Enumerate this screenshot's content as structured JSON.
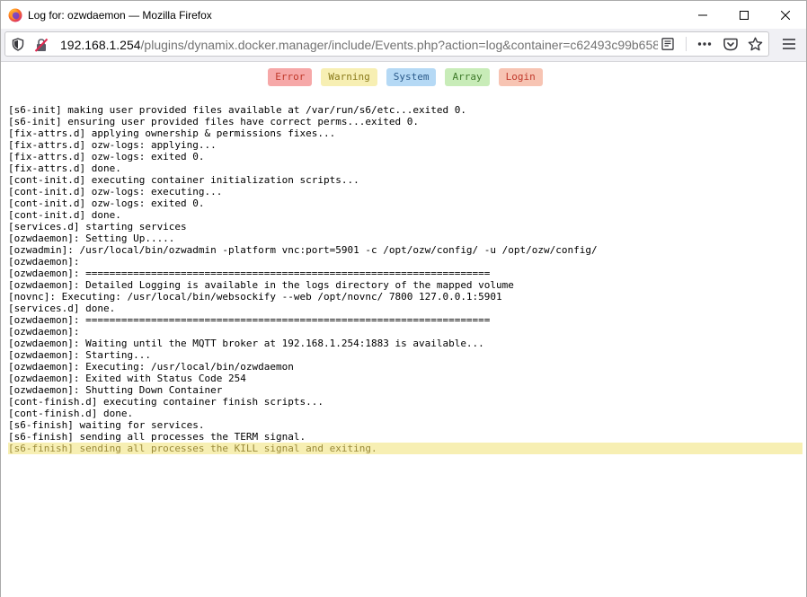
{
  "window": {
    "title": "Log for: ozwdaemon — Mozilla Firefox"
  },
  "urlbar": {
    "host": "192.168.1.254",
    "path": "/plugins/dynamix.docker.manager/include/Events.php?action=log&container=c62493c99b658"
  },
  "filters": [
    {
      "label": "Error",
      "bg": "#f6a8a8",
      "fg": "#c0392b"
    },
    {
      "label": "Warning",
      "bg": "#f7efb3",
      "fg": "#8a7a1a"
    },
    {
      "label": "System",
      "bg": "#b5d9f5",
      "fg": "#2a5a8a"
    },
    {
      "label": "Array",
      "bg": "#c8ecb8",
      "fg": "#3f7a2a"
    },
    {
      "label": "Login",
      "bg": "#f7c4b3",
      "fg": "#c0392b"
    }
  ],
  "log_lines": [
    "[s6-init] making user provided files available at /var/run/s6/etc...exited 0.",
    "[s6-init] ensuring user provided files have correct perms...exited 0.",
    "[fix-attrs.d] applying ownership & permissions fixes...",
    "[fix-attrs.d] ozw-logs: applying...",
    "[fix-attrs.d] ozw-logs: exited 0.",
    "[fix-attrs.d] done.",
    "[cont-init.d] executing container initialization scripts...",
    "[cont-init.d] ozw-logs: executing...",
    "[cont-init.d] ozw-logs: exited 0.",
    "[cont-init.d] done.",
    "[services.d] starting services",
    "[ozwdaemon]: Setting Up.....",
    "[ozwadmin]: /usr/local/bin/ozwadmin -platform vnc:port=5901 -c /opt/ozw/config/ -u /opt/ozw/config/",
    "[ozwdaemon]:",
    "[ozwdaemon]: ====================================================================",
    "[ozwdaemon]: Detailed Logging is available in the logs directory of the mapped volume",
    "[novnc]: Executing: /usr/local/bin/websockify --web /opt/novnc/ 7800 127.0.0.1:5901",
    "[services.d] done.",
    "[ozwdaemon]: ====================================================================",
    "[ozwdaemon]:",
    "[ozwdaemon]: Waiting until the MQTT broker at 192.168.1.254:1883 is available...",
    "[ozwdaemon]: Starting...",
    "[ozwdaemon]: Executing: /usr/local/bin/ozwdaemon",
    "[ozwdaemon]: Exited with Status Code 254",
    "[ozwdaemon]: Shutting Down Container",
    "[cont-finish.d] executing container finish scripts...",
    "[cont-finish.d] done.",
    "[s6-finish] waiting for services.",
    "[s6-finish] sending all processes the TERM signal.",
    "[s6-finish] sending all processes the KILL signal and exiting."
  ],
  "highlight_last_line_color": "#f7efb3"
}
